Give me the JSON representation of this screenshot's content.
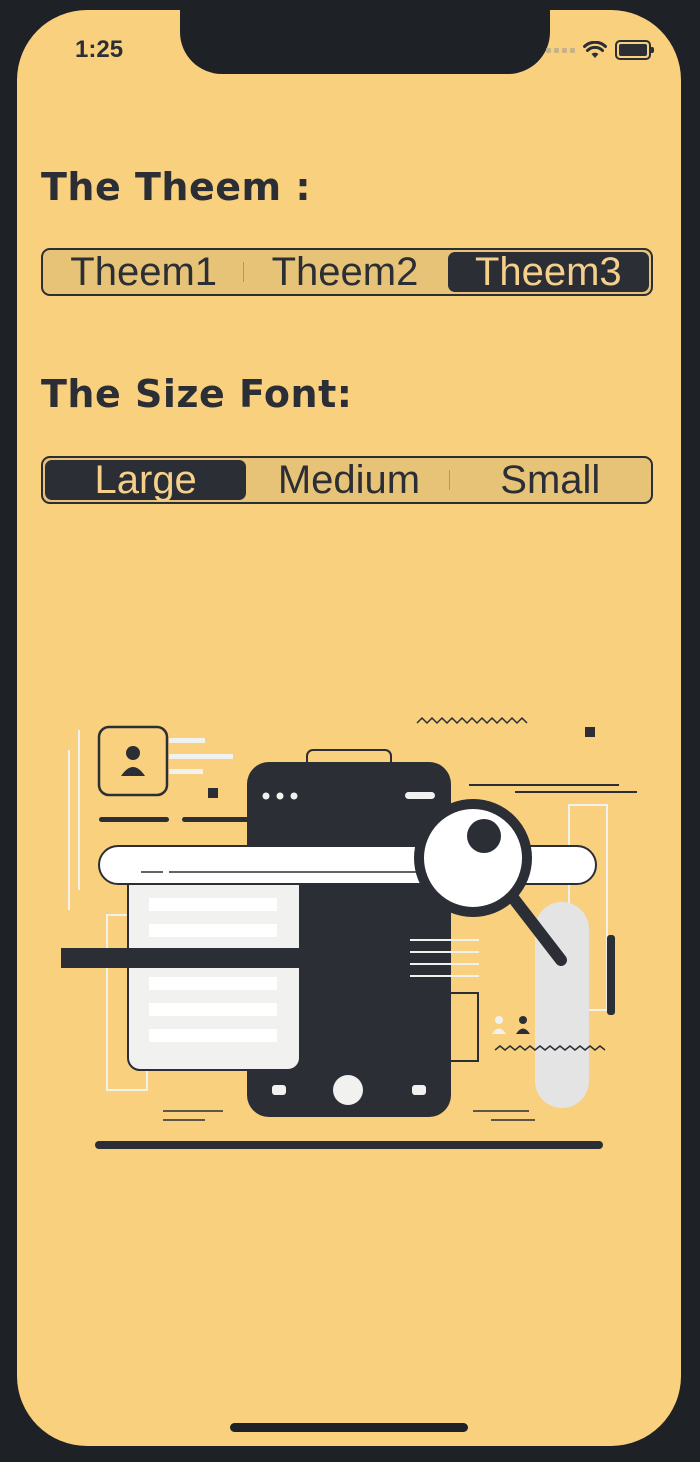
{
  "status": {
    "time": "1:25"
  },
  "colors": {
    "background": "#f8d07e",
    "dark": "#2b2e35",
    "segment_bg": "#e7c378",
    "light": "#f1f1f0"
  },
  "theme_section": {
    "title": "The Theem :",
    "options": [
      "Theem1",
      "Theem2",
      "Theem3"
    ],
    "selected": "Theem3"
  },
  "size_section": {
    "title": "The Size Font:",
    "options": [
      "Large",
      "Medium",
      "Small"
    ],
    "selected": "Large"
  },
  "illustration": {
    "icon": "search-app-illustration"
  }
}
